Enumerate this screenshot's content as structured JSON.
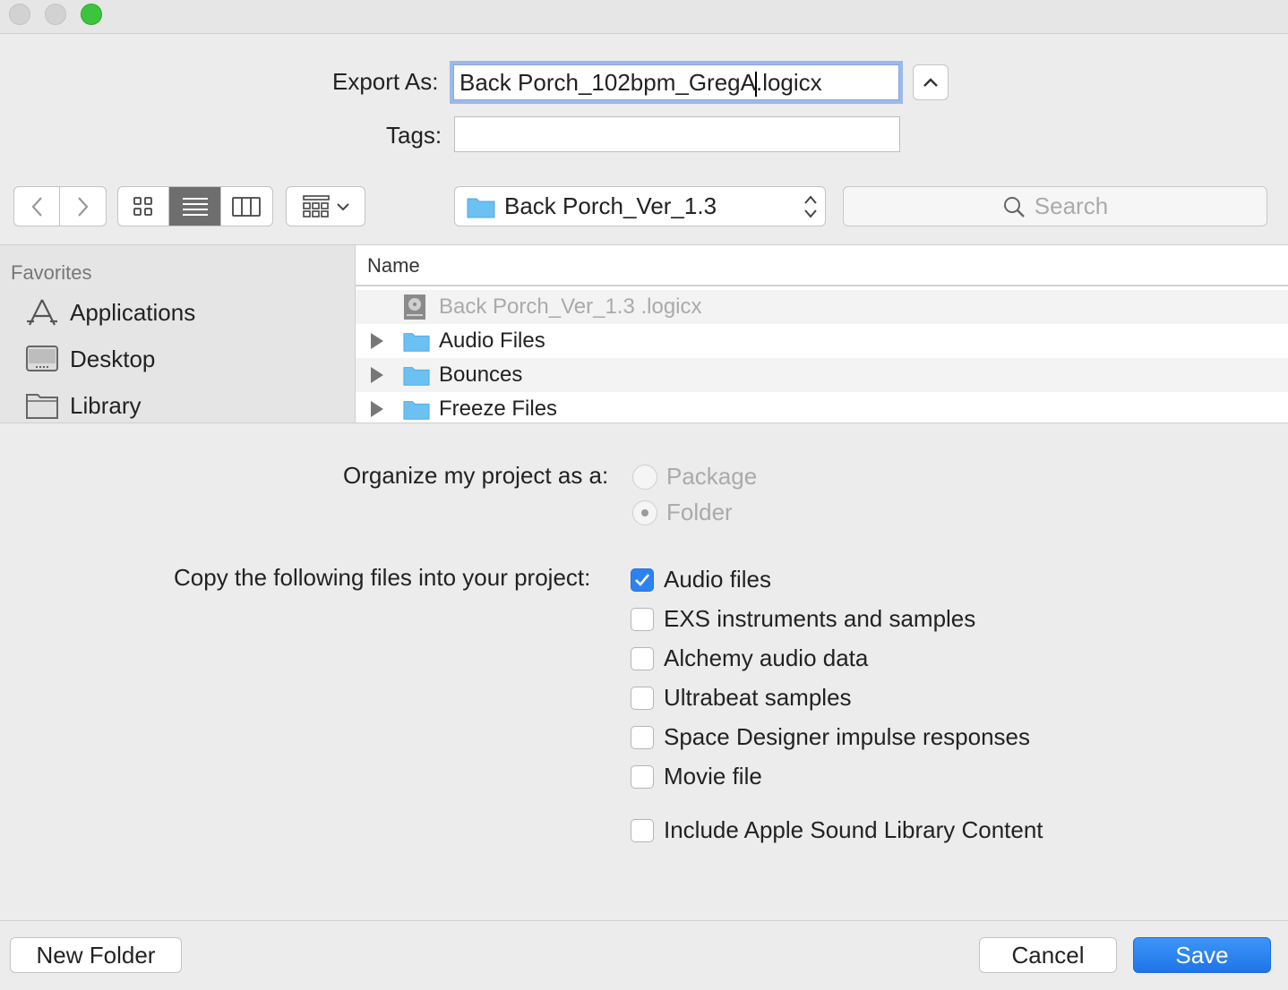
{
  "window": {
    "buttons": [
      "close",
      "minimize",
      "zoom"
    ]
  },
  "export_as": {
    "label": "Export As:",
    "value_before_caret": "Back Porch_102bpm_GregA",
    "value_after_caret": ".logicx"
  },
  "tags": {
    "label": "Tags:",
    "value": ""
  },
  "toolbar": {
    "location": "Back Porch_Ver_1.3",
    "search_placeholder": "Search"
  },
  "sidebar": {
    "heading": "Favorites",
    "items": [
      {
        "label": "Applications",
        "icon": "applications-icon"
      },
      {
        "label": "Desktop",
        "icon": "desktop-icon"
      },
      {
        "label": "Library",
        "icon": "folder-icon"
      }
    ]
  },
  "file_list": {
    "column": "Name",
    "rows": [
      {
        "name": "Back Porch_Ver_1.3 .logicx",
        "type": "project",
        "disabled": true
      },
      {
        "name": "Audio Files",
        "type": "folder"
      },
      {
        "name": "Bounces",
        "type": "folder"
      },
      {
        "name": "Freeze Files",
        "type": "folder"
      }
    ]
  },
  "organize": {
    "label": "Organize my project as a:",
    "options": [
      "Package",
      "Folder"
    ],
    "selected": "Folder"
  },
  "copy_files": {
    "label": "Copy the following files into your project:",
    "options": [
      {
        "label": "Audio files",
        "checked": true
      },
      {
        "label": "EXS instruments and samples",
        "checked": false
      },
      {
        "label": "Alchemy audio data",
        "checked": false
      },
      {
        "label": "Ultrabeat samples",
        "checked": false
      },
      {
        "label": "Space Designer impulse responses",
        "checked": false
      },
      {
        "label": "Movie file",
        "checked": false
      },
      {
        "label": "Include Apple Sound Library Content",
        "checked": false
      }
    ]
  },
  "footer": {
    "new_folder": "New Folder",
    "cancel": "Cancel",
    "save": "Save"
  },
  "colors": {
    "accent": "#1f74e8",
    "focus_ring": "#9ab9ec",
    "folder": "#6cc0f2",
    "zoom_button": "#3cc43d"
  }
}
